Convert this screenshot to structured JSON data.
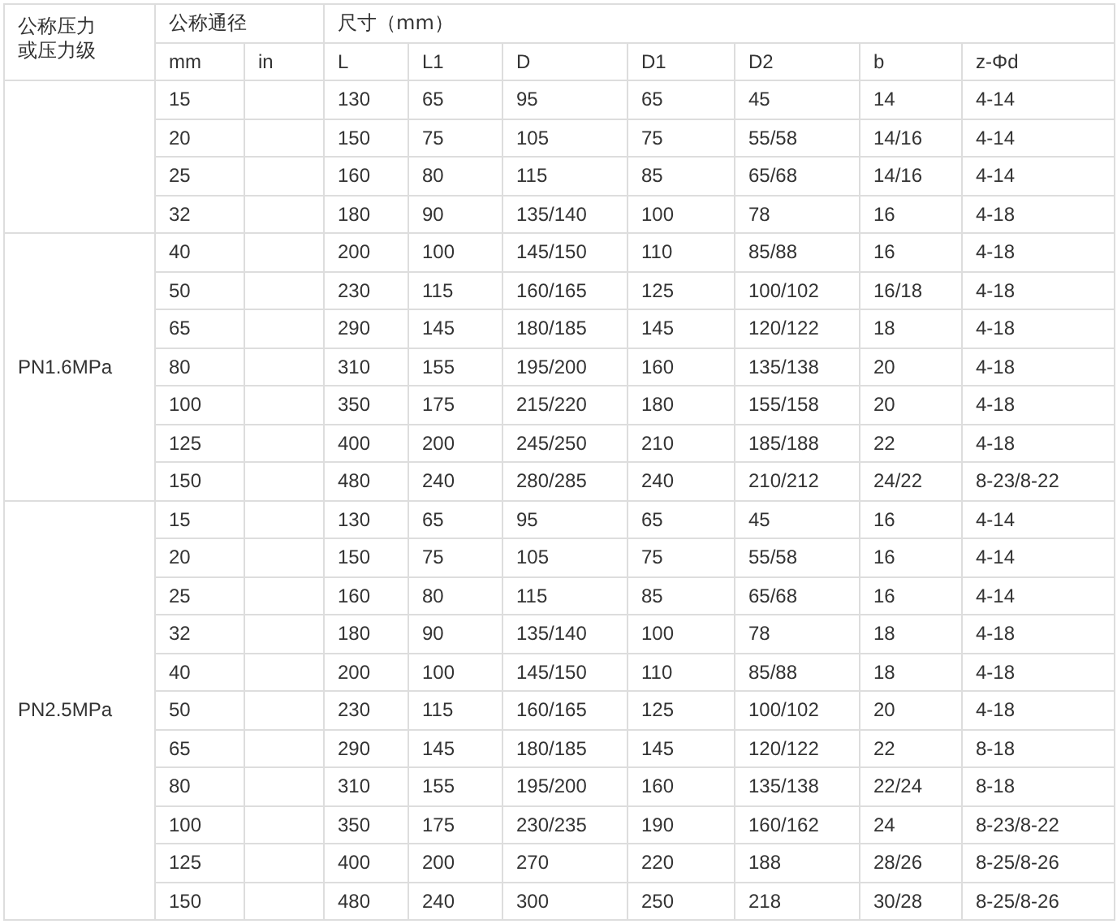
{
  "table": {
    "header_top": [
      {
        "text": "公称压力或压力级",
        "rowspan": 2
      },
      {
        "text": "公称通径",
        "colspan": 2
      },
      {
        "text": "尺寸（mm）",
        "colspan": 7
      }
    ],
    "header_sub": [
      "mm",
      "in",
      "L",
      "L1",
      "D",
      "D1",
      "D2",
      "b",
      "z-Φd"
    ],
    "groups": [
      {
        "rows": [
          [
            "15",
            "130",
            "65",
            "95",
            "65",
            "45",
            "14",
            "4-14"
          ],
          [
            "20",
            "150",
            "75",
            "105",
            "75",
            "55/58",
            "14/16",
            "4-14"
          ],
          [
            "25",
            "160",
            "80",
            "115",
            "85",
            "65/68",
            "14/16",
            "4-14"
          ],
          [
            "32",
            "180",
            "90",
            "135/140",
            "100",
            "78",
            "16",
            "4-18"
          ]
        ]
      },
      {
        "label": "PN1.6MPa",
        "rows": [
          [
            "40",
            "200",
            "100",
            "145/150",
            "110",
            "85/88",
            "16",
            "4-18"
          ],
          [
            "50",
            "230",
            "115",
            "160/165",
            "125",
            "100/102",
            "16/18",
            "4-18"
          ],
          [
            "65",
            "290",
            "145",
            "180/185",
            "145",
            "120/122",
            "18",
            "4-18"
          ],
          [
            "80",
            "310",
            "155",
            "195/200",
            "160",
            "135/138",
            "20",
            "4-18"
          ],
          [
            "100",
            "350",
            "175",
            "215/220",
            "180",
            "155/158",
            "20",
            "4-18"
          ],
          [
            "125",
            "400",
            "200",
            "245/250",
            "210",
            "185/188",
            "22",
            "4-18"
          ],
          [
            "150",
            "480",
            "240",
            "280/285",
            "240",
            "210/212",
            "24/22",
            "8-23/8-22"
          ]
        ]
      },
      {
        "label": "PN2.5MPa",
        "rows": [
          [
            "15",
            "130",
            "65",
            "95",
            "65",
            "45",
            "16",
            "4-14"
          ],
          [
            "20",
            "150",
            "75",
            "105",
            "75",
            "55/58",
            "16",
            "4-14"
          ],
          [
            "25",
            "160",
            "80",
            "115",
            "85",
            "65/68",
            "16",
            "4-14"
          ],
          [
            "32",
            "180",
            "90",
            "135/140",
            "100",
            "78",
            "18",
            "4-18"
          ],
          [
            "40",
            "200",
            "100",
            "145/150",
            "110",
            "85/88",
            "18",
            "4-18"
          ],
          [
            "50",
            "230",
            "115",
            "160/165",
            "125",
            "100/102",
            "20",
            "4-18"
          ],
          [
            "65",
            "290",
            "145",
            "180/185",
            "145",
            "120/122",
            "22",
            "8-18"
          ],
          [
            "80",
            "310",
            "155",
            "195/200",
            "160",
            "135/138",
            "22/24",
            "8-18"
          ],
          [
            "100",
            "350",
            "175",
            "230/235",
            "190",
            "160/162",
            "24",
            "8-23/8-22"
          ],
          [
            "125",
            "400",
            "200",
            "270",
            "220",
            "188",
            "28/26",
            "8-25/8-26"
          ],
          [
            "150",
            "480",
            "240",
            "300",
            "250",
            "218",
            "30/28",
            "8-25/8-26"
          ]
        ]
      }
    ]
  }
}
